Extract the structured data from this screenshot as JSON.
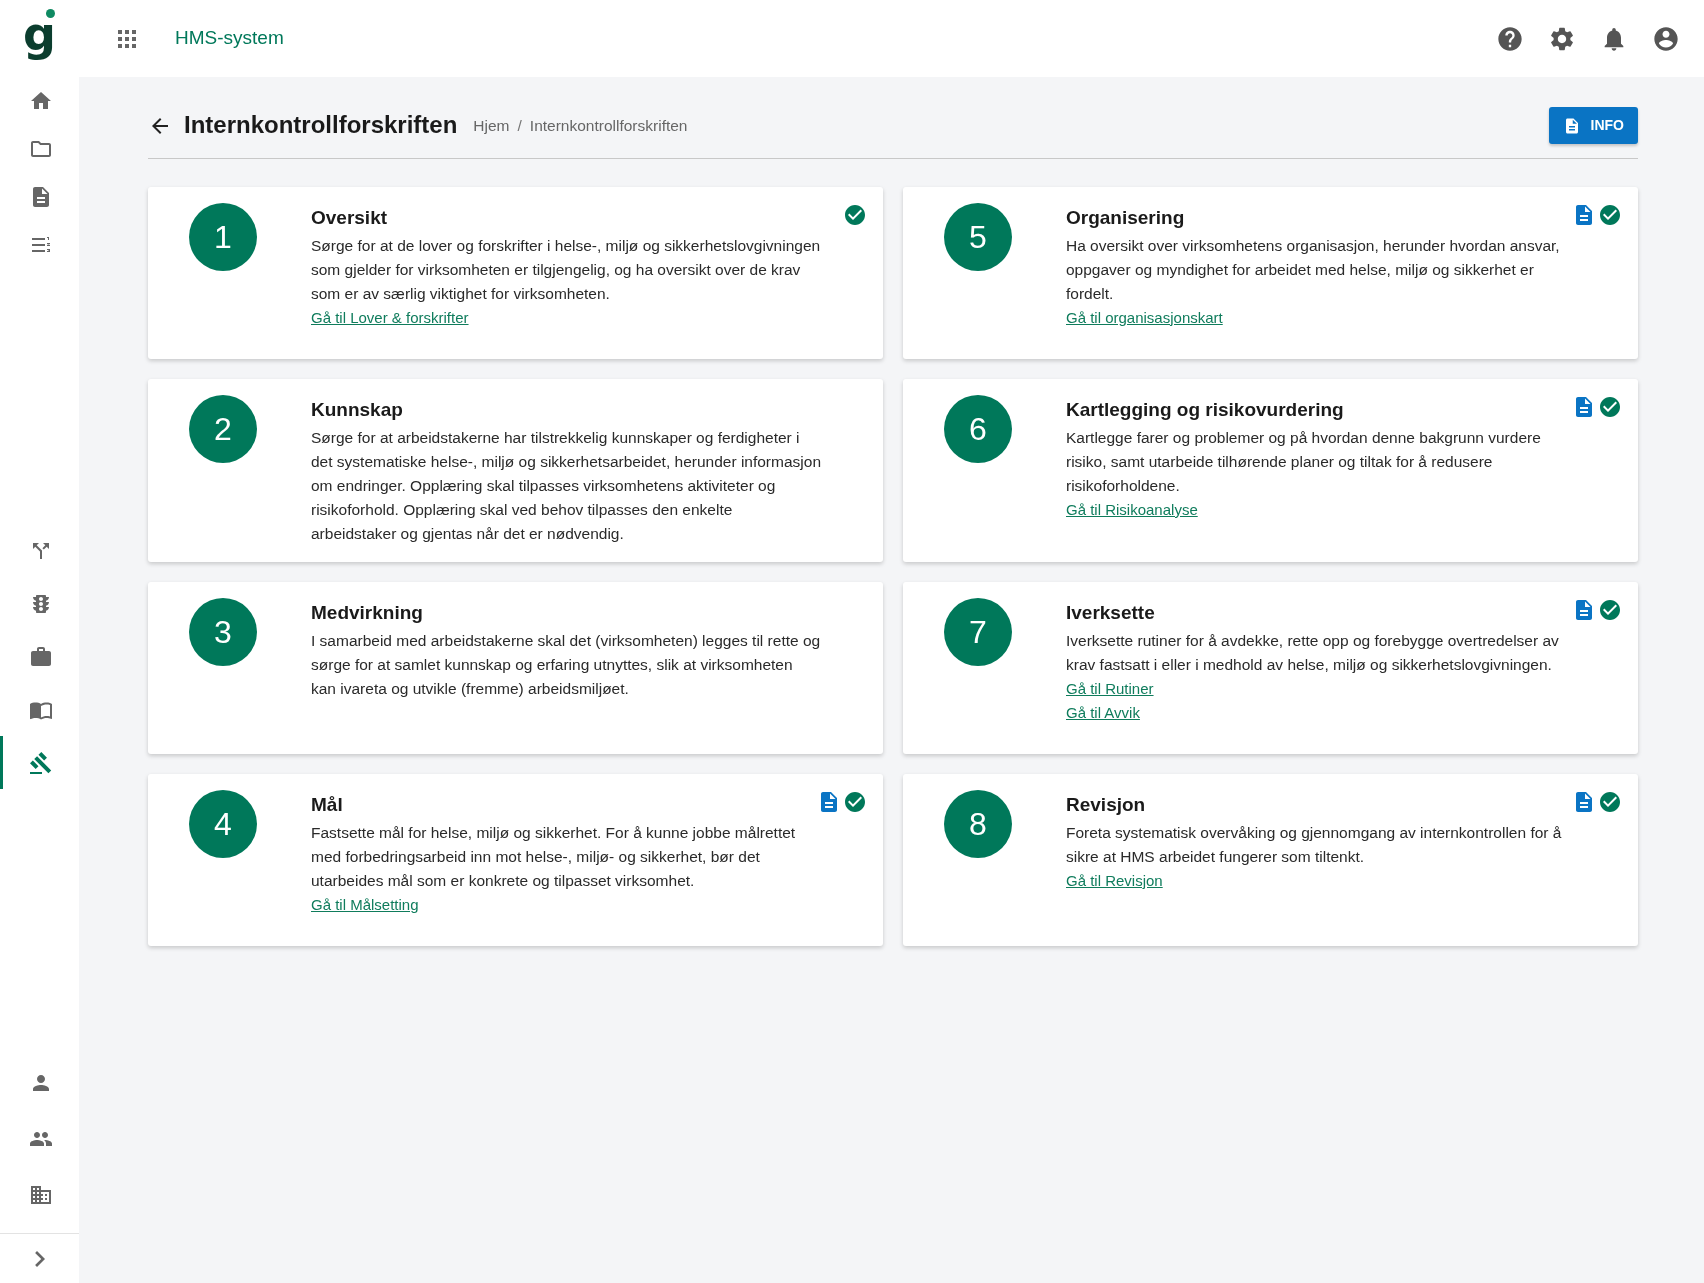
{
  "header": {
    "logo": "g",
    "app_title": "HMS-system"
  },
  "sidebar": {
    "top_items": [
      {
        "selected": false
      },
      {
        "selected": false
      },
      {
        "selected": false
      },
      {
        "selected": false
      }
    ],
    "middle_items": [
      {
        "selected": false
      },
      {
        "selected": false
      },
      {
        "selected": false
      },
      {
        "selected": false
      },
      {
        "selected": true
      }
    ],
    "bottom_items": [
      {
        "selected": false
      },
      {
        "selected": false
      },
      {
        "selected": false
      }
    ]
  },
  "page": {
    "title": "Internkontrollforskriften",
    "breadcrumbs": [
      "Hjem",
      "Internkontrollforskriften"
    ],
    "breadcrumb_separator": "/",
    "info_button": "INFO"
  },
  "cards": [
    {
      "number": "1",
      "title": "Oversikt",
      "text": "Sørge for at de lover og forskrifter i helse-, miljø og sikkerhetslovgivningen som gjelder for virksomheten er tilgjengelig, og ha oversikt over de krav som er av særlig viktighet for virksomheten.",
      "links": [
        "Gå til Lover & forskrifter"
      ],
      "has_document": false,
      "completed": true
    },
    {
      "number": "2",
      "title": "Kunnskap",
      "text": "Sørge for at arbeidstakerne har tilstrekkelig kunnskaper og ferdigheter i det systematiske helse-, miljø og sikkerhetsarbeidet, herunder informasjon om endringer. Opplæring skal tilpasses virksomhetens aktiviteter og risikoforhold. Opplæring skal ved behov tilpasses den enkelte arbeidstaker og gjentas når det er nødvendig.",
      "has_document": false,
      "completed": false
    },
    {
      "number": "3",
      "title": "Medvirkning",
      "text": "I samarbeid med arbeidstakerne skal det (virksomheten) legges til rette og sørge for at samlet kunnskap og erfaring utnyttes, slik at virksomheten kan ivareta og utvikle (fremme) arbeidsmiljøet.",
      "has_document": false,
      "completed": false
    },
    {
      "number": "4",
      "title": "Mål",
      "text": "Fastsette mål for helse, miljø og sikkerhet. For å kunne jobbe målrettet med forbedringsarbeid inn mot helse-, miljø- og sikkerhet, bør det utarbeides mål som er konkrete og tilpasset virksomhet.",
      "links": [
        "Gå til Målsetting"
      ],
      "has_document": true,
      "completed": true
    },
    {
      "number": "5",
      "title": "Organisering",
      "text": "Ha oversikt over virksomhetens organisasjon, herunder hvordan ansvar, oppgaver og myndighet for arbeidet med helse, miljø og sikkerhet er fordelt.",
      "links": [
        "Gå til organisasjonskart"
      ],
      "has_document": true,
      "completed": true
    },
    {
      "number": "6",
      "title": "Kartlegging og risikovurdering",
      "text": "Kartlegge farer og problemer og på hvordan denne bakgrunn vurdere risiko, samt utarbeide tilhørende planer og tiltak for å redusere risikoforholdene.",
      "links": [
        "Gå til Risikoanalyse"
      ],
      "has_document": true,
      "completed": true
    },
    {
      "number": "7",
      "title": "Iverksette",
      "text": "Iverksette rutiner for å avdekke, rette opp og forebygge overtredelser av krav fastsatt i eller i medhold av helse, miljø og sikkerhetslovgivningen.",
      "links": [
        "Gå til Rutiner",
        "Gå til Avvik"
      ],
      "has_document": true,
      "completed": true
    },
    {
      "number": "8",
      "title": "Revisjon",
      "text": "Foreta systematisk overvåking og gjennomgang av internkontrollen for å sikre at HMS arbeidet fungerer som tiltenkt.",
      "links": [
        "Gå til Revisjon"
      ],
      "has_document": true,
      "completed": true
    }
  ]
}
